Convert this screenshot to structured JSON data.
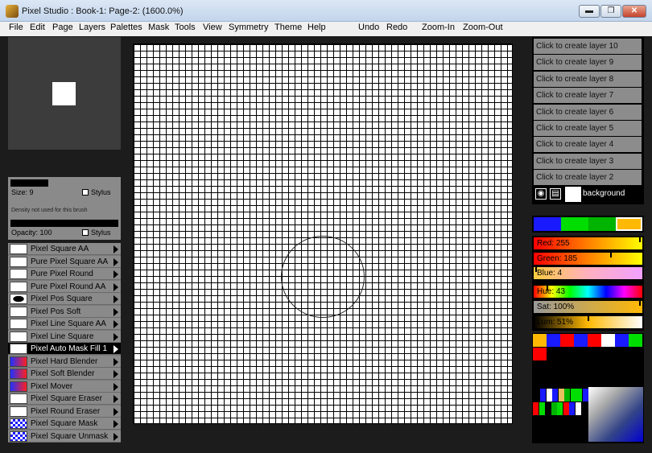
{
  "window": {
    "title": "Pixel Studio : Book-1: Page-2:  (1600.0%)",
    "min_label": "▬",
    "max_label": "❐",
    "close_label": "✕"
  },
  "menu": {
    "items": [
      "File",
      "Edit",
      "Page",
      "Layers",
      "Palettes",
      "Mask",
      "Tools",
      "View",
      "Symmetry",
      "Theme",
      "Help"
    ],
    "undo": "Undo",
    "redo": "Redo",
    "zoom_in": "Zoom-In",
    "zoom_out": "Zoom-Out"
  },
  "brush_settings": {
    "size_label": "Size: 9",
    "stylus_label": "Stylus",
    "density_note": "Density not used for this brush",
    "opacity_label": "Opacity: 100"
  },
  "brushes": [
    {
      "label": "Pixel Square AA"
    },
    {
      "label": "Pure Pixel Square AA"
    },
    {
      "label": "Pure Pixel Round"
    },
    {
      "label": "Pure Pixel Round AA"
    },
    {
      "label": "Pixel Pos Square"
    },
    {
      "label": "Pixel Pos Soft"
    },
    {
      "label": "Pixel Line Square AA"
    },
    {
      "label": "Pixel Line Square"
    },
    {
      "label": "Pixel Auto Mask Fill 1"
    },
    {
      "label": "Pixel Hard Blender"
    },
    {
      "label": "Pixel Soft Blender"
    },
    {
      "label": "Pixel Mover"
    },
    {
      "label": "Pixel Square Eraser"
    },
    {
      "label": "Pixel Round Eraser"
    },
    {
      "label": "Pixel Square Mask"
    },
    {
      "label": "Pixel Square Unmask"
    }
  ],
  "active_brush_index": 8,
  "layers": {
    "create_buttons": [
      "Click to create layer 10",
      "Click to create layer 9",
      "Click to create layer 8",
      "Click to create layer 7",
      "Click to create layer 6",
      "Click to create layer 5",
      "Click to create layer 4",
      "Click to create layer 3",
      "Click to create layer 2"
    ],
    "background_label": "background"
  },
  "color": {
    "red_label": "Red: 255",
    "green_label": "Green: 185",
    "blue_label": "Blue: 4",
    "hue_label": "Hue: 43",
    "sat_label": "Sat: 100%",
    "lum_label": "Lum: 51%",
    "red": 255,
    "green": 185,
    "blue": 4,
    "hue": 43,
    "sat": 100,
    "lum": 51,
    "current_color": "#ffb904",
    "colorbar_swatches": [
      "#1a1aff",
      "#00dd00",
      "#00b400",
      "#ffb904"
    ],
    "palette_row1": [
      "#ffb904",
      "#1a1aff",
      "#ff0000",
      "#1a1aff",
      "#ff0000",
      "#ffffff",
      "#1a1aff",
      "#00dd00"
    ],
    "palette_row2": [
      "#ff0000"
    ],
    "mini_row1": [
      "#1a1aff",
      "#ffffff",
      "#1a1aff",
      "#e8c060",
      "#00b400",
      "#00dd00",
      "#00dd00",
      "#1a1aff"
    ],
    "mini_row2": [
      "#ff0000",
      "#00dd00",
      "#000000",
      "#00b400",
      "#00dd00",
      "#ff0000",
      "#1a1aff",
      "#ffffff"
    ]
  }
}
